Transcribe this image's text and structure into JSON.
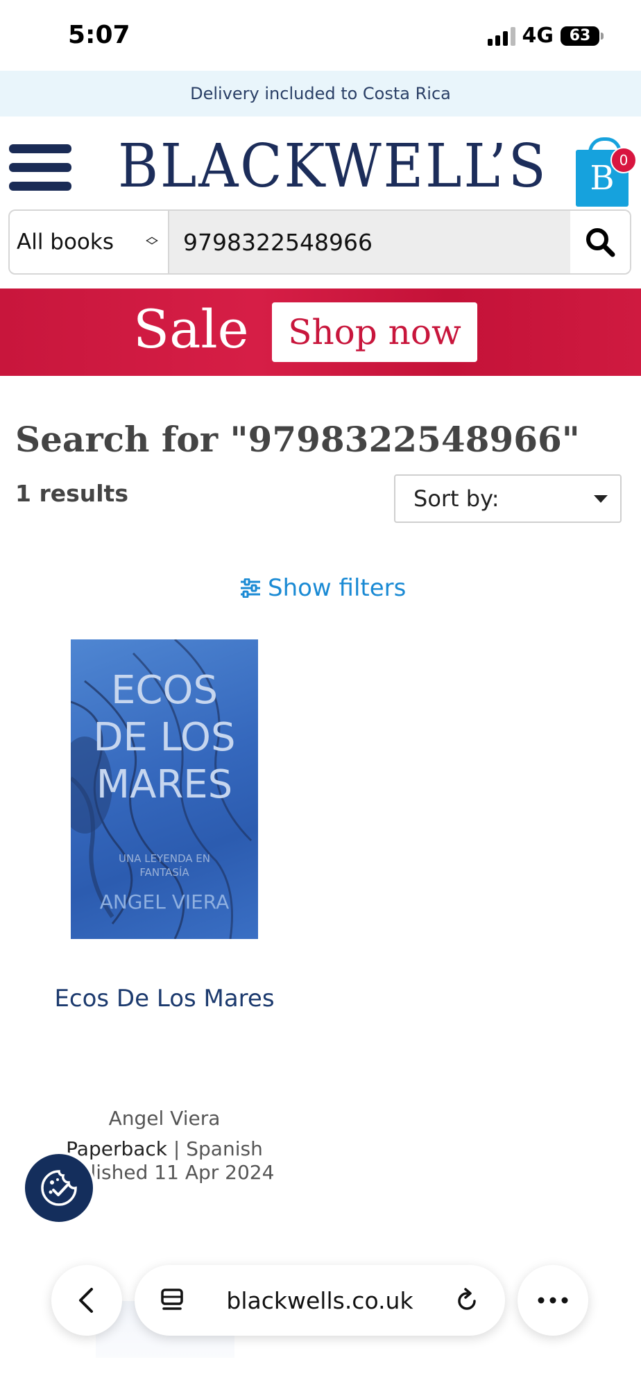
{
  "status": {
    "time": "5:07",
    "network": "4G",
    "battery": "63"
  },
  "banner": {
    "delivery": "Delivery included to Costa Rica"
  },
  "header": {
    "logo": "BLACKWELL’S",
    "cart_count": "0",
    "cart_letter": "B"
  },
  "search": {
    "category": "All books",
    "query": "9798322548966"
  },
  "promo": {
    "sale": "Sale",
    "shop_now": "Shop now"
  },
  "results": {
    "heading": "Search for \"9798322548966\"",
    "count": "1 results",
    "sort_label": "Sort by:",
    "show_filters": "Show filters"
  },
  "book": {
    "cover_title": "ECOS\nDE LOS\nMARES",
    "cover_subtitle": "UNA LEYENDA EN\nFANTASÍA",
    "cover_author": "ANGEL VIERA",
    "title": "Ecos De Los Mares",
    "author": "Angel Viera",
    "format": "Paperback",
    "separator": " | ",
    "language": "Spanish",
    "published": "Published 11 Apr 2024"
  },
  "browser": {
    "url": "blackwells.co.uk"
  },
  "colors": {
    "navy": "#1c2d5a",
    "sale_red": "#c8163c",
    "link_blue": "#1a8ad4",
    "cart_blue": "#16a2dd",
    "badge_red": "#d8153f"
  }
}
